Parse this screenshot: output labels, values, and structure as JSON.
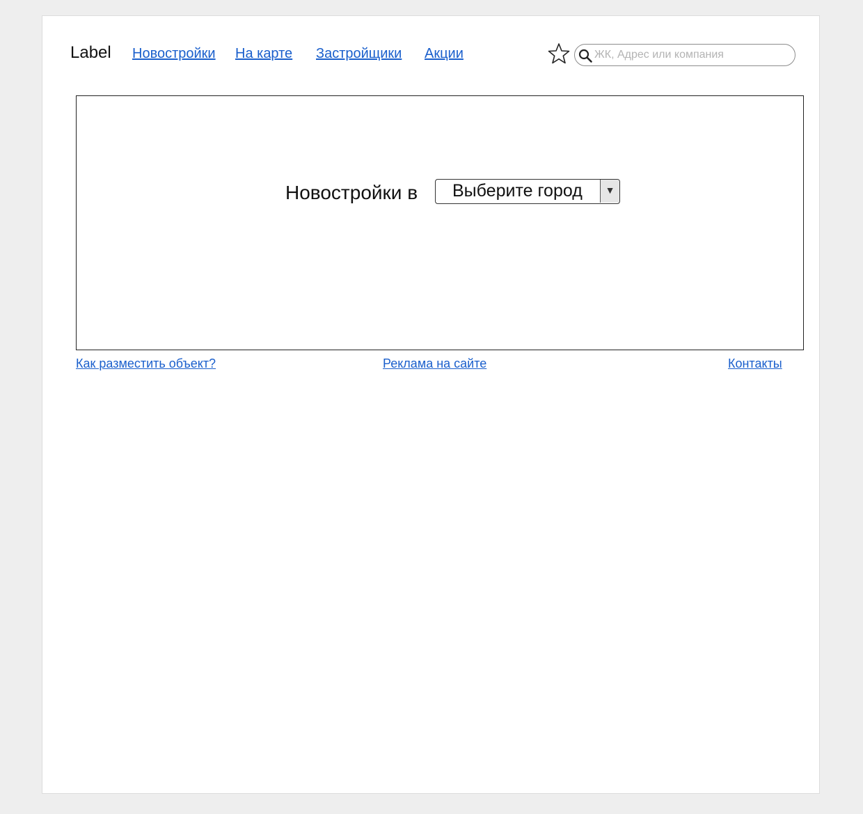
{
  "header": {
    "logo": "Label",
    "nav": [
      {
        "label": "Новостройки"
      },
      {
        "label": "На карте"
      },
      {
        "label": "Застройщики"
      },
      {
        "label": "Акции"
      }
    ],
    "favorites_icon": "star-icon",
    "search": {
      "icon": "search-icon",
      "placeholder": "ЖК, Адрес или компания",
      "value": ""
    }
  },
  "hero": {
    "title": "Новостройки в",
    "city_select": {
      "value": "Выберите город",
      "arrow": "▼"
    }
  },
  "footer": {
    "links": [
      {
        "label": "Как разместить объект?"
      },
      {
        "label": "Реклама на сайте"
      },
      {
        "label": "Контакты"
      }
    ]
  },
  "colors": {
    "link": "#1a5fcc",
    "page_background": "#eeeeee",
    "frame_background": "#ffffff"
  }
}
